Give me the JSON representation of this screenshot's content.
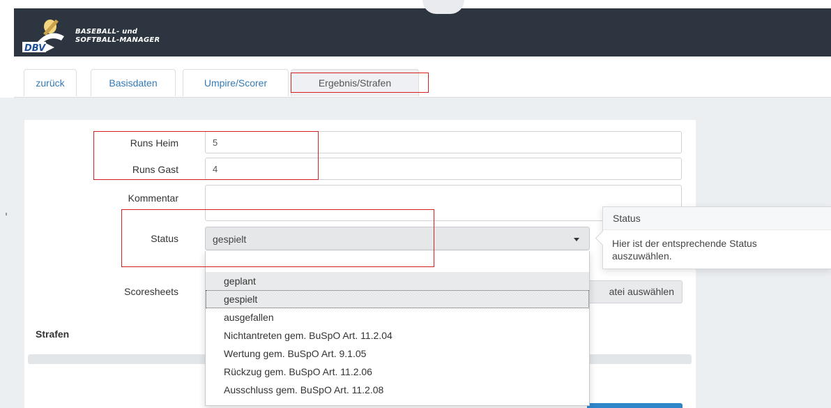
{
  "header": {
    "logo_line1": "BASEBALL- und",
    "logo_line2": "SOFTBALL-MANAGER",
    "logo_badge": "DBV",
    "brand_colors": {
      "bar": "#2d3640",
      "ball": "#f2d680",
      "badge": "#1e4f99"
    }
  },
  "tabs": [
    {
      "label": "zurück"
    },
    {
      "label": "Basisdaten"
    },
    {
      "label": "Umpire/Scorer"
    },
    {
      "label": "Ergebnis/Strafen",
      "active": true
    }
  ],
  "form": {
    "runs_heim": {
      "label": "Runs Heim",
      "value": "5"
    },
    "runs_gast": {
      "label": "Runs Gast",
      "value": "4"
    },
    "kommentar": {
      "label": "Kommentar",
      "value": ""
    },
    "status": {
      "label": "Status",
      "value": "gespielt",
      "options": [
        "geplant",
        "gespielt",
        "ausgefallen",
        "Nichtantreten gem. BuSpO Art. 11.2.04",
        "Wertung gem. BuSpO Art. 9.1.05",
        "Rückzug gem. BuSpO Art. 11.2.06",
        "Ausschluss gem. BuSpO Art. 11.2.08"
      ]
    },
    "scoresheets": {
      "label": "Scoresheets",
      "button_text": "atei auswählen"
    },
    "section_penalties": "Strafen"
  },
  "popover": {
    "title": "Status",
    "body": "Hier ist der entsprechende Status auszuwählen."
  },
  "colors": {
    "link": "#337ab7",
    "highlight": "#d81e1e",
    "primary": "#2f86c9"
  }
}
